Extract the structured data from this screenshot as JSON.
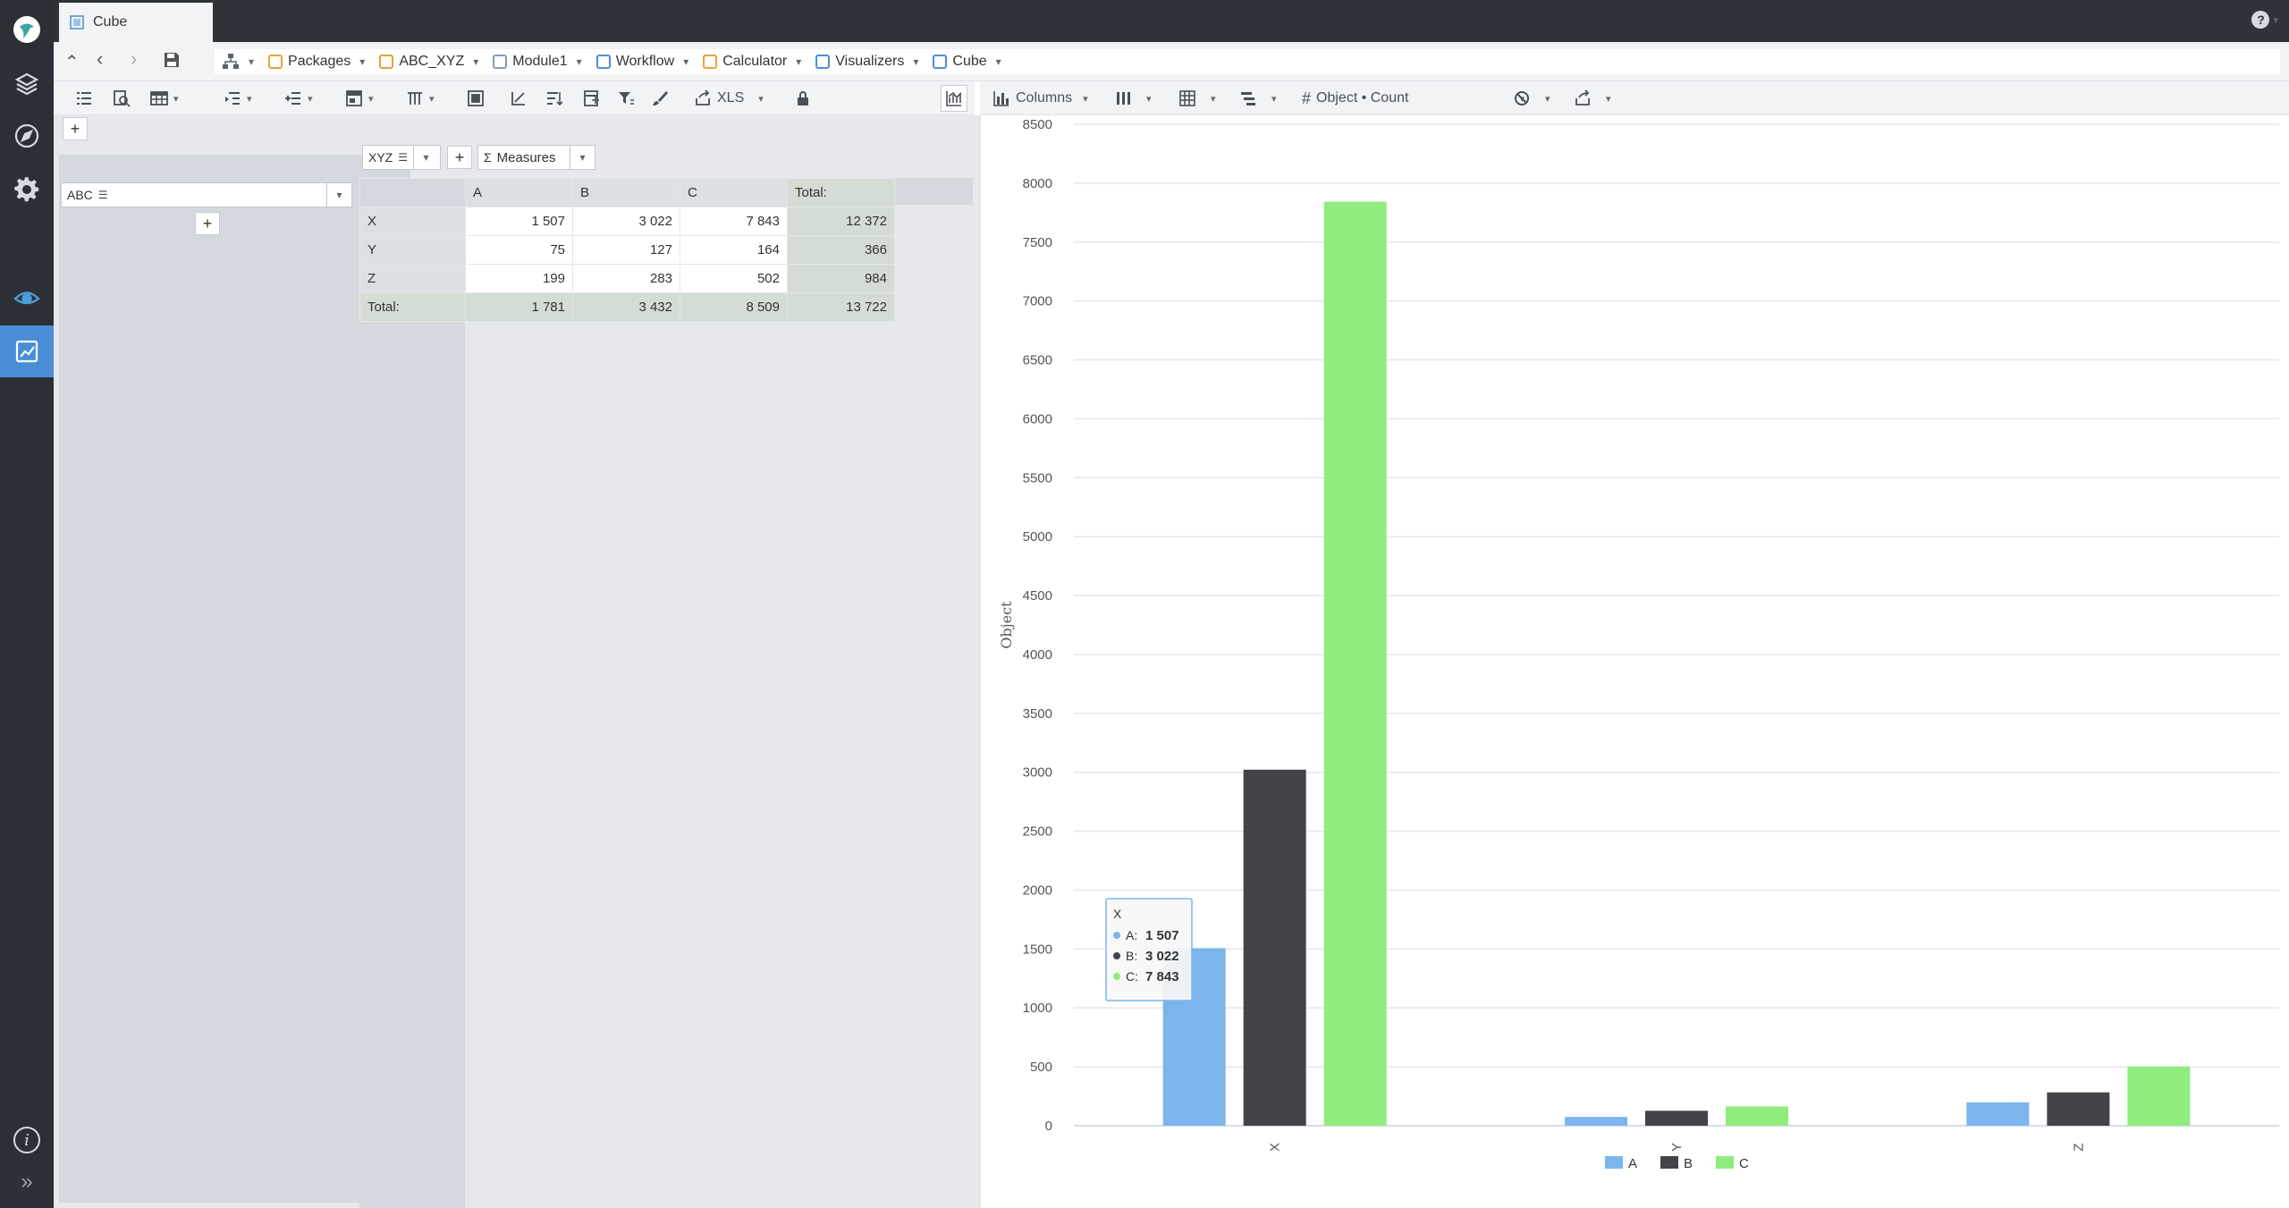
{
  "window": {
    "tab_title": "Cube",
    "help_glyph": "?"
  },
  "rail": {
    "items": [
      {
        "name": "logo",
        "icon": "app-logo-icon"
      },
      {
        "name": "packages",
        "icon": "layers-icon"
      },
      {
        "name": "explore",
        "icon": "compass-icon"
      },
      {
        "name": "settings",
        "icon": "gear-icon"
      },
      {
        "name": "visualize",
        "icon": "eye-icon"
      },
      {
        "name": "reports",
        "icon": "chart-edit-icon"
      }
    ],
    "info_glyph": "i",
    "expand_glyph": "»"
  },
  "breadcrumb": {
    "items": [
      {
        "label": "Packages",
        "icon": "package-icon",
        "color": "#e6a23c"
      },
      {
        "label": "ABC_XYZ",
        "icon": "package-icon",
        "color": "#e6a23c"
      },
      {
        "label": "Module1",
        "icon": "module-icon",
        "color": "#8a9bb5"
      },
      {
        "label": "Workflow",
        "icon": "workflow-icon",
        "color": "#4a8fd6"
      },
      {
        "label": "Calculator",
        "icon": "calculator-icon",
        "color": "#e6a23c"
      },
      {
        "label": "Visualizers",
        "icon": "folder-icon",
        "color": "#4a8fd6"
      },
      {
        "label": "Cube",
        "icon": "cube-icon",
        "color": "#4a8fd6"
      }
    ]
  },
  "left_toolbar": {
    "export_label": "XLS"
  },
  "right_toolbar": {
    "chart_type_label": "Columns",
    "measure_label": "Object • Count"
  },
  "pivot": {
    "row_field": "ABC",
    "column_field": "XYZ",
    "measures_label": "Measures",
    "measures_glyph": "Σ",
    "columns": [
      "A",
      "B",
      "C",
      "Total:"
    ],
    "rows": [
      {
        "label": "X",
        "values": [
          "1 507",
          "3 022",
          "7 843"
        ],
        "total": "12 372"
      },
      {
        "label": "Y",
        "values": [
          "75",
          "127",
          "164"
        ],
        "total": "366"
      },
      {
        "label": "Z",
        "values": [
          "199",
          "283",
          "502"
        ],
        "total": "984"
      }
    ],
    "total_row": {
      "label": "Total:",
      "values": [
        "1 781",
        "3 432",
        "8 509"
      ],
      "total": "13 722"
    }
  },
  "chart_data": {
    "type": "bar",
    "categories": [
      "X",
      "Y",
      "Z"
    ],
    "series": [
      {
        "name": "A",
        "color": "#7cb5ec",
        "values": [
          1507,
          75,
          199
        ]
      },
      {
        "name": "B",
        "color": "#434348",
        "values": [
          3022,
          127,
          283
        ]
      },
      {
        "name": "C",
        "color": "#90ed7d",
        "values": [
          7843,
          164,
          502
        ]
      }
    ],
    "ylabel": "Object",
    "xlabel": "",
    "ylim": [
      0,
      8500
    ],
    "ytick_step": 500,
    "grid": true,
    "legend_position": "bottom-center",
    "tooltip": {
      "title": "X",
      "lines": [
        {
          "name": "A",
          "value": "1 507",
          "color": "#7cb5ec"
        },
        {
          "name": "B",
          "value": "3 022",
          "color": "#434348"
        },
        {
          "name": "C",
          "value": "7 843",
          "color": "#90ed7d"
        }
      ]
    }
  }
}
